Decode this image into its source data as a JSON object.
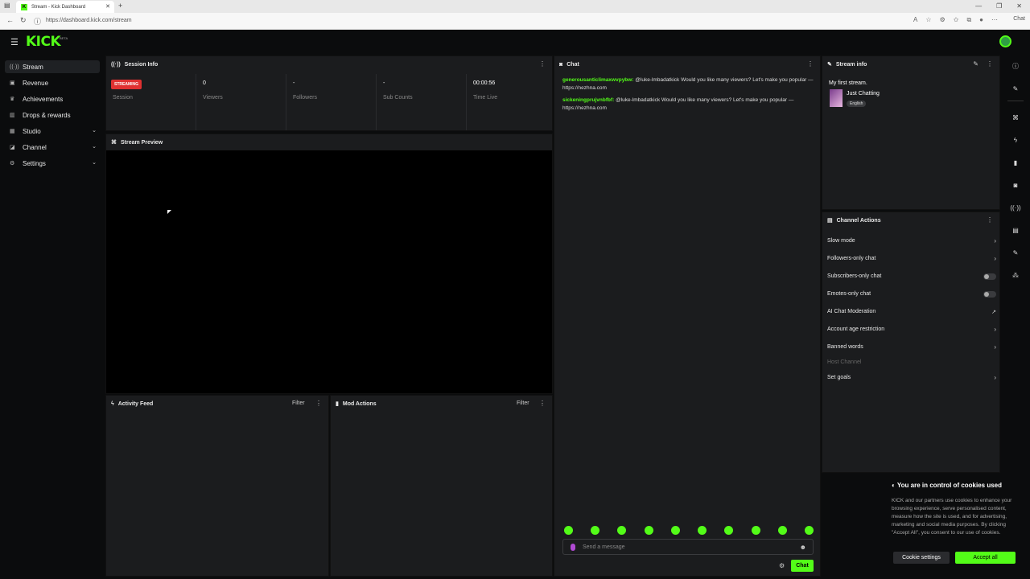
{
  "browser": {
    "tab_title": "Stream - Kick Dashboard",
    "tab_favicon": "K",
    "url": "https://dashboard.kick.com/stream",
    "copilot_label": "Chat"
  },
  "header": {
    "logo": "KICK",
    "beta": "BETA"
  },
  "sidebar": {
    "items": [
      {
        "label": "Stream",
        "icon": "broadcast-icon"
      },
      {
        "label": "Revenue",
        "icon": "wallet-icon"
      },
      {
        "label": "Achievements",
        "icon": "trophy-icon"
      },
      {
        "label": "Drops & rewards",
        "icon": "gift-icon"
      },
      {
        "label": "Studio",
        "icon": "grid-icon"
      },
      {
        "label": "Channel",
        "icon": "channel-icon"
      },
      {
        "label": "Settings",
        "icon": "gear-icon"
      }
    ]
  },
  "session_info": {
    "title": "Session Info",
    "stats": [
      {
        "value": "STREAMING",
        "label": "Session"
      },
      {
        "value": "0",
        "label": "Viewers"
      },
      {
        "value": "-",
        "label": "Followers"
      },
      {
        "value": "-",
        "label": "Sub Counts"
      },
      {
        "value": "00:00:56",
        "label": "Time Live"
      }
    ]
  },
  "stream_preview": {
    "title": "Stream Preview"
  },
  "activity_feed": {
    "title": "Activity Feed",
    "filter": "Filter"
  },
  "mod_actions": {
    "title": "Mod Actions",
    "filter": "Filter"
  },
  "chat": {
    "title": "Chat",
    "messages": [
      {
        "user": "generousanticlimaxwvpybw:",
        "text": " @luke-lmbadatkick Would you like many viewers? Let's make you popular — https://nezhna.com"
      },
      {
        "user": "sickeningprujvnbfbf:",
        "text": " @luke-lmbadatkick Would you like many viewers? Let's make you popular — https://nezhna.com"
      }
    ],
    "input_placeholder": "Send a message",
    "send_label": "Chat"
  },
  "stream_info": {
    "title": "Stream info",
    "stream_title": "My first stream.",
    "category": "Just Chatting",
    "language": "English"
  },
  "channel_actions": {
    "title": "Channel Actions",
    "items": [
      {
        "label": "Slow mode",
        "control": "chevron"
      },
      {
        "label": "Followers-only chat",
        "control": "chevron"
      },
      {
        "label": "Subscribers-only chat",
        "control": "toggle"
      },
      {
        "label": "Emotes-only chat",
        "control": "toggle"
      },
      {
        "label": "AI Chat Moderation",
        "control": "external"
      },
      {
        "label": "Account age restriction",
        "control": "chevron"
      },
      {
        "label": "Banned words",
        "control": "chevron"
      },
      {
        "label": "Host Channel",
        "control": "disabled"
      },
      {
        "label": "Set goals",
        "control": "chevron"
      }
    ]
  },
  "cookie_banner": {
    "title": "You are in control of cookies used",
    "body": "KICK and our partners use cookies to enhance your browsing experience, serve personalised content, measure how the site is used, and for advertising, marketing and social media purposes. By clicking \"Accept All\", you consent to our use of cookies.",
    "settings_label": "Cookie settings",
    "accept_label": "Accept all"
  },
  "colors": {
    "brand": "#53fc18",
    "live_badge": "#e03131",
    "panel_bg": "#1b1c1e",
    "page_bg": "#0b0c0d"
  }
}
